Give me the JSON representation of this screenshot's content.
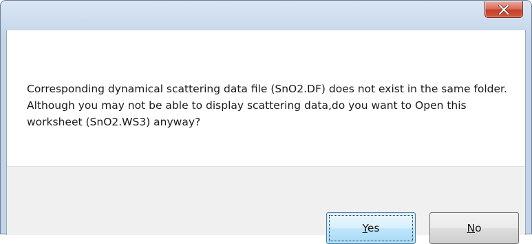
{
  "dialog": {
    "close_symbol": "X",
    "message": "Corresponding dynamical scattering data file (SnO2.DF) does not exist in the same folder. Although you may not be able to display scattering data,do you want to Open this worksheet (SnO2.WS3) anyway?",
    "buttons": {
      "yes_accel": "Y",
      "yes_rest": "es",
      "no_accel": "N",
      "no_rest": "o"
    }
  },
  "icons": {
    "close": "close-icon"
  },
  "colors": {
    "frame": "#c9d9ec",
    "close_button": "#c4402a",
    "default_button_border": "#3c7fb1",
    "footer": "#f0f0f0"
  }
}
